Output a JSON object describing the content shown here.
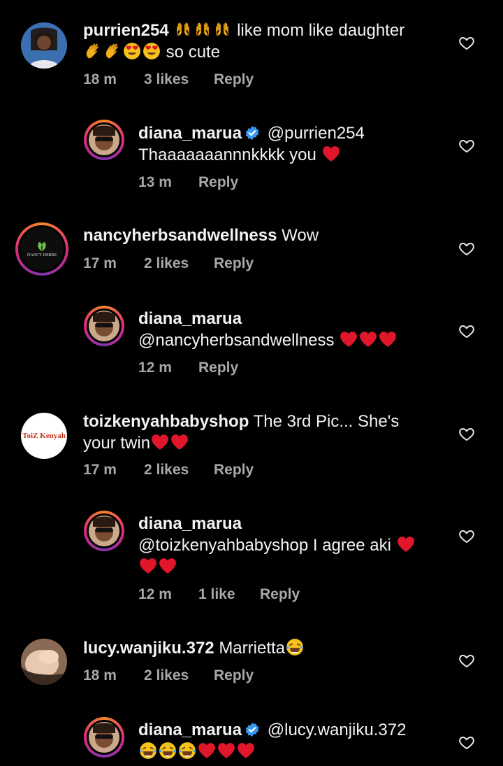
{
  "comments": [
    {
      "username": "purrien254",
      "text": "like mom like daughter",
      "text2": "so cute",
      "time": "18 m",
      "likes": "3 likes",
      "reply": "Reply"
    },
    {
      "username": "diana_marua",
      "mention": "@purrien254",
      "text": "Thaaaaaaannnkkkk you",
      "time": "13 m",
      "reply": "Reply"
    },
    {
      "username": "nancyherbsandwellness",
      "text": "Wow",
      "time": "17 m",
      "likes": "2 likes",
      "reply": "Reply",
      "avatar_label": "NANCY HERBS"
    },
    {
      "username": "diana_marua",
      "mention": "@nancyherbsandwellness",
      "time": "12 m",
      "reply": "Reply"
    },
    {
      "username": "toizkenyahbabyshop",
      "text": "The 3rd Pic... She's",
      "text2": "your twin",
      "time": "17 m",
      "likes": "2 likes",
      "reply": "Reply",
      "avatar_label": "ToiZ Kenyah"
    },
    {
      "username": "diana_marua",
      "mention": "@toizkenyahbabyshop",
      "text": "I agree aki",
      "time": "12 m",
      "likes": "1 like",
      "reply": "Reply"
    },
    {
      "username": "lucy.wanjiku.372",
      "text": "Marrietta",
      "time": "18 m",
      "likes": "2 likes",
      "reply": "Reply"
    },
    {
      "username": "diana_marua",
      "mention": "@lucy.wanjiku.372"
    }
  ],
  "icons": {
    "heart": "heart-outline-icon",
    "verified": "verified-badge-icon"
  },
  "colors": {
    "meta": "#a8a8a8",
    "verified": "#3897f0",
    "heart_emoji": "#e0162b"
  }
}
